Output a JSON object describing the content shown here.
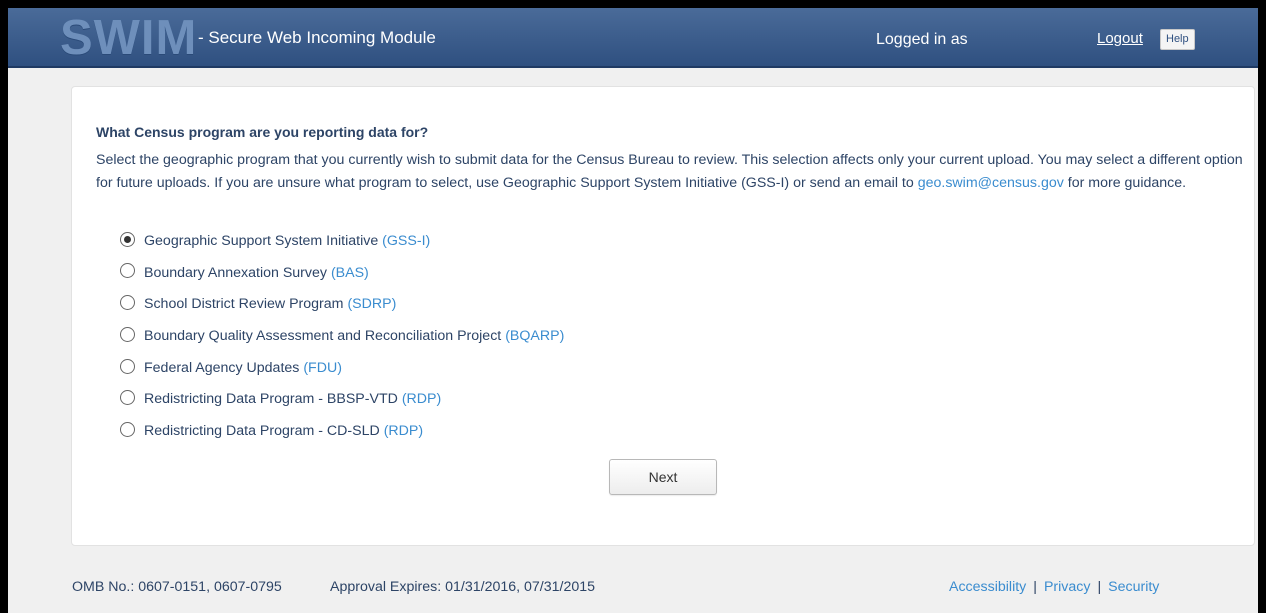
{
  "header": {
    "logo": "SWIM",
    "subtitle": "- Secure Web Incoming Module",
    "logged_in": "Logged in as",
    "logout": "Logout",
    "help": "Help"
  },
  "main": {
    "question": "What Census program are you reporting data for?",
    "description_part1": "Select the geographic program that you currently wish to submit data for the Census Bureau to review. This selection affects only your current upload. You may select a different option for future uploads. If you are unsure what program to select, use Geographic Support System Initiative (GSS-I) or send an email to",
    "email": "geo.swim@census.gov",
    "description_part2": "for more guidance.",
    "options": [
      {
        "label": "Geographic Support System Initiative",
        "abbr": "(GSS-I)",
        "selected": true
      },
      {
        "label": "Boundary Annexation Survey",
        "abbr": "(BAS)",
        "selected": false
      },
      {
        "label": "School District Review Program",
        "abbr": "(SDRP)",
        "selected": false
      },
      {
        "label": "Boundary Quality Assessment and Reconciliation Project",
        "abbr": "(BQARP)",
        "selected": false
      },
      {
        "label": "Federal Agency Updates",
        "abbr": "(FDU)",
        "selected": false
      },
      {
        "label": "Redistricting Data Program - BBSP-VTD",
        "abbr": "(RDP)",
        "selected": false
      },
      {
        "label": "Redistricting Data Program - CD-SLD",
        "abbr": "(RDP)",
        "selected": false
      }
    ],
    "next_label": "Next"
  },
  "footer": {
    "omb": "OMB No.: 0607-0151, 0607-0795",
    "approval": "Approval Expires: 01/31/2016, 07/31/2015",
    "links": [
      "Accessibility",
      "Privacy",
      "Security"
    ],
    "separator": "|"
  },
  "colors": {
    "header_bg": "#3d5e8e",
    "text": "#2d4466",
    "link": "#3a8ccf"
  }
}
